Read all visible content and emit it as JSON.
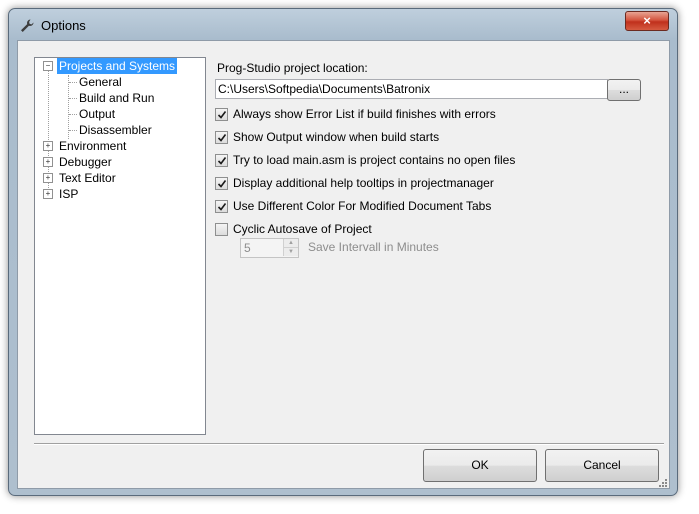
{
  "window": {
    "title": "Options",
    "close_label": "×"
  },
  "tree": {
    "items": [
      {
        "label": "Projects and Systems",
        "expander": "−",
        "selected": true
      },
      {
        "label": "General"
      },
      {
        "label": "Build and Run"
      },
      {
        "label": "Output"
      },
      {
        "label": "Disassembler"
      },
      {
        "label": "Environment",
        "expander": "+"
      },
      {
        "label": "Debugger",
        "expander": "+"
      },
      {
        "label": "Text Editor",
        "expander": "+"
      },
      {
        "label": "ISP",
        "expander": "+"
      }
    ]
  },
  "project": {
    "location_label": "Prog-Studio project location:",
    "location_value": "C:\\Users\\Softpedia\\Documents\\Batronix",
    "browse_label": "..."
  },
  "options": [
    {
      "label": "Always show Error List if build finishes with errors",
      "checked": true
    },
    {
      "label": "Show Output window when build starts",
      "checked": true
    },
    {
      "label": "Try to load main.asm is project contains no open files",
      "checked": true
    },
    {
      "label": "Display additional help tooltips in projectmanager",
      "checked": true
    },
    {
      "label": "Use Different Color For Modified Document Tabs",
      "checked": true
    },
    {
      "label": "Cyclic Autosave of Project",
      "checked": false
    }
  ],
  "autosave": {
    "interval_value": "5",
    "interval_label": "Save Intervall in Minutes"
  },
  "buttons": {
    "ok": "OK",
    "cancel": "Cancel"
  },
  "colors": {
    "selection": "#3399ff",
    "frame": "#aebfce",
    "client": "#f0f0f0"
  }
}
